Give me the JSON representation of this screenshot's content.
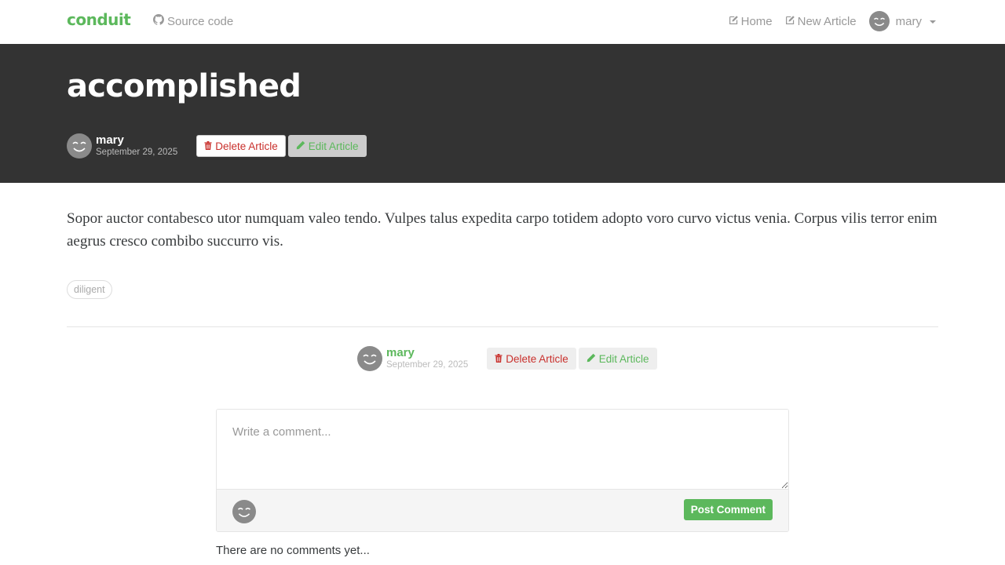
{
  "navbar": {
    "brand": "conduit",
    "source_link": "Source code",
    "home": "Home",
    "new_article": "New Article",
    "user": "mary"
  },
  "article": {
    "title": "accomplished",
    "author": "mary",
    "date": "September 29, 2025",
    "body": "Sopor auctor contabesco utor numquam valeo tendo. Vulpes talus expedita carpo totidem adopto voro curvo victus venia. Corpus vilis terror enim aegrus cresco combibo succurro vis.",
    "tags": [
      "diligent"
    ],
    "delete_label": "Delete Article",
    "edit_label": "Edit Article"
  },
  "comments": {
    "placeholder": "Write a comment...",
    "post_label": "Post Comment",
    "empty_text": "There are no comments yet..."
  },
  "colors": {
    "accent": "#5cb85c",
    "banner": "#333333",
    "danger": "#c9302c"
  }
}
